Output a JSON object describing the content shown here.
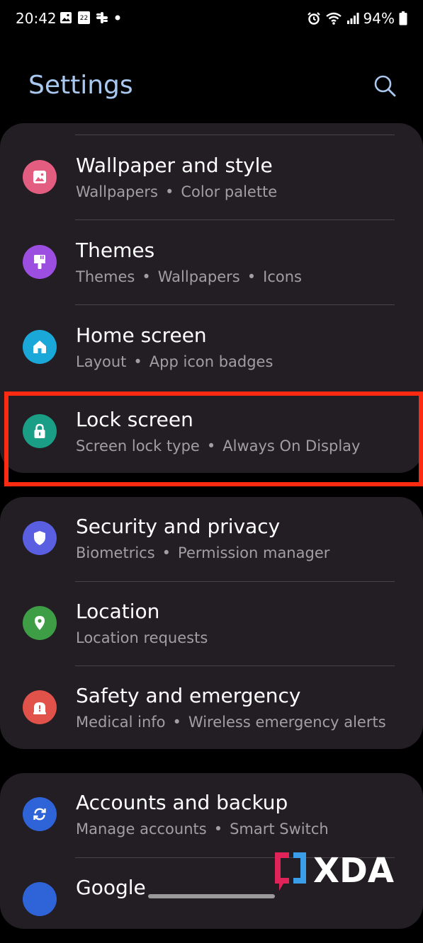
{
  "status_bar": {
    "time": "20:42",
    "calendar_day": "22",
    "battery": "94%"
  },
  "header": {
    "title": "Settings"
  },
  "cards": [
    {
      "items": [
        {
          "title": "Wallpaper and style",
          "sub": [
            "Wallpapers",
            "Color palette"
          ],
          "icon": "wallpaper-icon",
          "color": "#e35d80"
        },
        {
          "title": "Themes",
          "sub": [
            "Themes",
            "Wallpapers",
            "Icons"
          ],
          "icon": "paintbrush-icon",
          "color": "#9b4ee0"
        },
        {
          "title": "Home screen",
          "sub": [
            "Layout",
            "App icon badges"
          ],
          "icon": "home-icon",
          "color": "#1aa8d8"
        },
        {
          "title": "Lock screen",
          "sub": [
            "Screen lock type",
            "Always On Display"
          ],
          "icon": "lock-icon",
          "color": "#1a9e85"
        }
      ]
    },
    {
      "items": [
        {
          "title": "Security and privacy",
          "sub": [
            "Biometrics",
            "Permission manager"
          ],
          "icon": "shield-icon",
          "color": "#5a5ee0"
        },
        {
          "title": "Location",
          "sub": [
            "Location requests"
          ],
          "icon": "location-pin-icon",
          "color": "#3e9e46"
        },
        {
          "title": "Safety and emergency",
          "sub": [
            "Medical info",
            "Wireless emergency alerts"
          ],
          "icon": "emergency-icon",
          "color": "#e0524a"
        }
      ]
    },
    {
      "items": [
        {
          "title": "Accounts and backup",
          "sub": [
            "Manage accounts",
            "Smart Switch"
          ],
          "icon": "sync-icon",
          "color": "#2f64d8"
        },
        {
          "title": "Google",
          "sub": [],
          "icon": "google-icon",
          "color": "#2f64d8"
        }
      ]
    }
  ],
  "highlight_color": "#ff2a12",
  "watermark": {
    "text": "XDA"
  }
}
